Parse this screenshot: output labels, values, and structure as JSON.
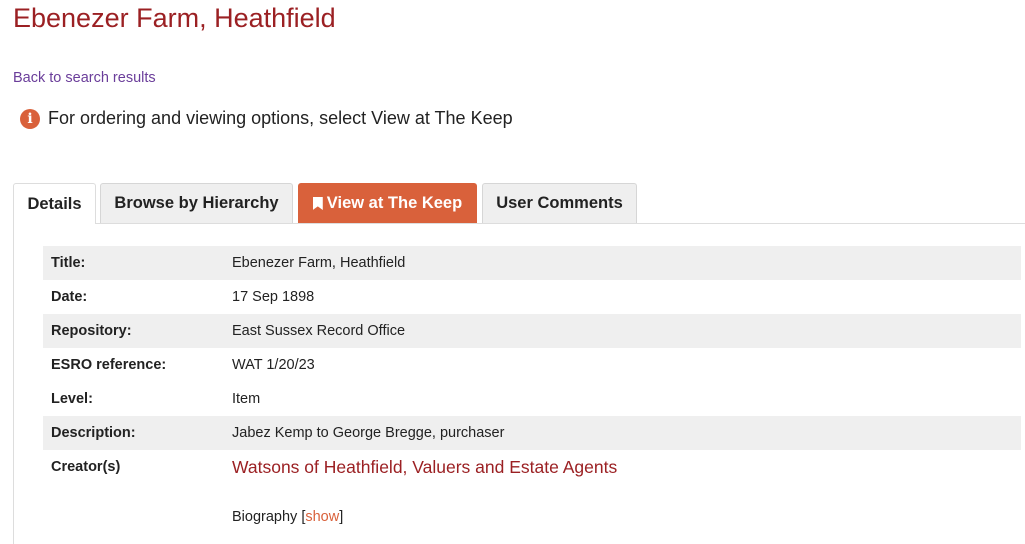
{
  "page": {
    "title": "Ebenezer Farm, Heathfield",
    "back_link": "Back to search results",
    "notice": "For ordering and viewing options, select View at The Keep"
  },
  "tabs": [
    {
      "label": "Details",
      "active": true
    },
    {
      "label": "Browse by Hierarchy",
      "active": false
    },
    {
      "label": "View at The Keep",
      "active": false,
      "icon": "bookmark-icon"
    },
    {
      "label": "User Comments",
      "active": false
    }
  ],
  "details": [
    {
      "label": "Title:",
      "value": "Ebenezer Farm, Heathfield"
    },
    {
      "label": "Date:",
      "value": "17 Sep 1898"
    },
    {
      "label": "Repository:",
      "value": "East Sussex Record Office"
    },
    {
      "label": "ESRO reference:",
      "value": "WAT 1/20/23"
    },
    {
      "label": "Level:",
      "value": "Item"
    },
    {
      "label": "Description:",
      "value": "Jabez Kemp to George Bregge, purchaser"
    },
    {
      "label": "Creator(s)",
      "value": "Watsons of Heathfield, Valuers and Estate Agents"
    }
  ],
  "biography": {
    "label": "Biography",
    "open_bracket": "[",
    "link": "show",
    "close_bracket": "]"
  },
  "colors": {
    "title": "#9b2023",
    "accent": "#d9613b",
    "link_purple": "#6a3d9a",
    "row_shade": "#efefef"
  }
}
